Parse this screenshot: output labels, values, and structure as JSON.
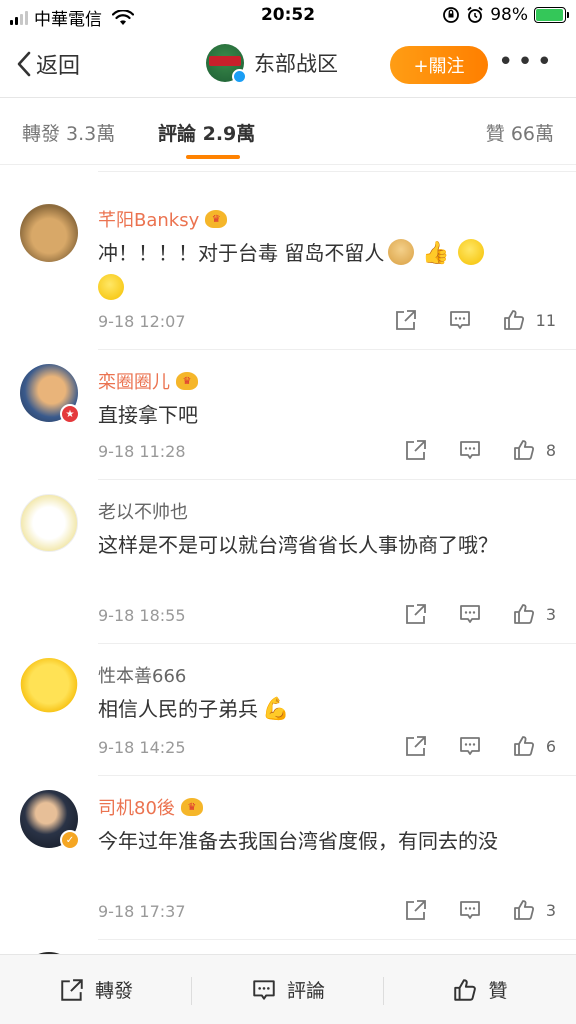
{
  "status_bar": {
    "carrier": "中華電信",
    "time": "20:52",
    "battery": "98%",
    "battery_level": 0.98
  },
  "nav": {
    "back_label": "返回",
    "title": "东部战区",
    "follow_label": "+關注",
    "more_label": "•••",
    "verified_color": "#1a9ef5",
    "accent": "#ff8200"
  },
  "tabs": [
    {
      "label": "轉發 3.3萬",
      "active": false
    },
    {
      "label": "評論 2.9萬",
      "active": true
    },
    {
      "label": "贊 66萬",
      "active": false
    }
  ],
  "comments": [
    {
      "name": "芊阳Banksy",
      "vip": true,
      "text_before": "冲！！！！对于台毒 留岛不留人",
      "emojis": [
        "doge",
        "thumbs-up",
        "smile",
        "smile"
      ],
      "time": "9-18 12:07",
      "likes": "11"
    },
    {
      "name": "栾圈圈儿",
      "vip": true,
      "text_before": "直接拿下吧",
      "time": "9-18 11:28",
      "likes": "8"
    },
    {
      "name": "老以不帅也",
      "vip": false,
      "text_before": "这样是不是可以就台湾省省长人事协商了哦？",
      "time": "9-18 18:55",
      "likes": "3"
    },
    {
      "name": "性本善666",
      "vip": false,
      "text_before": "相信人民的子弟兵",
      "emojis": [
        "flexed-arm"
      ],
      "time": "9-18 14:25",
      "likes": "6"
    },
    {
      "name": "司机80後",
      "vip": true,
      "text_before": "今年过年准备去我国台湾省度假，有同去的没",
      "time": "9-18 17:37",
      "likes": "3"
    }
  ],
  "bottom_bar": {
    "repost_label": "轉發",
    "comment_label": "評論",
    "like_label": "贊"
  }
}
